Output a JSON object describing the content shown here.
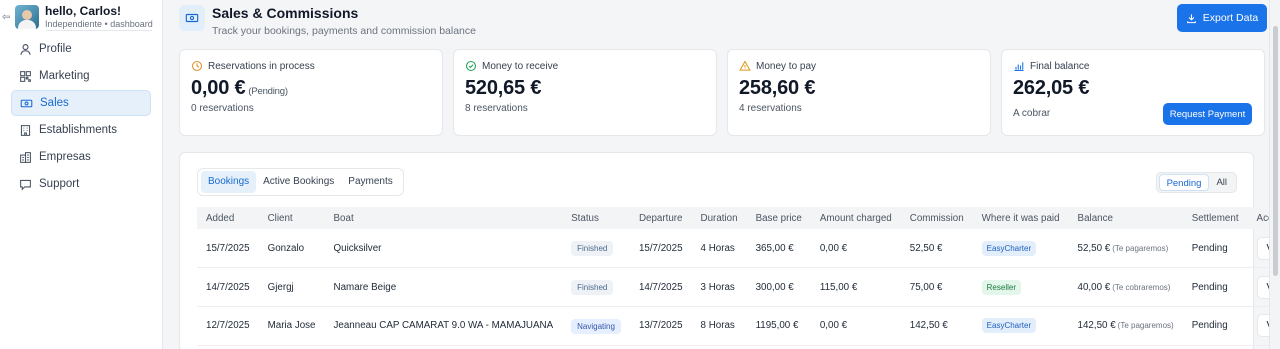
{
  "user": {
    "name": "hello, Carlos!",
    "subtitle": "Independiente • dashboard"
  },
  "sidebar": {
    "items": [
      {
        "label": "Profile",
        "icon": "user-icon"
      },
      {
        "label": "Marketing",
        "icon": "qr-icon"
      },
      {
        "label": "Sales",
        "icon": "sales-icon",
        "active": true
      },
      {
        "label": "Establishments",
        "icon": "building-icon"
      },
      {
        "label": "Empresas",
        "icon": "company-icon"
      },
      {
        "label": "Support",
        "icon": "chat-icon"
      }
    ]
  },
  "header": {
    "title": "Sales & Commissions",
    "subtitle": "Track your bookings, payments and commission balance",
    "export_label": "Export Data"
  },
  "cards": {
    "reservations": {
      "title": "Reservations in process",
      "amount": "0,00 €",
      "note": "(Pending)",
      "sub": "0 reservations"
    },
    "receive": {
      "title": "Money to receive",
      "amount": "520,65 €",
      "sub": "8 reservations"
    },
    "pay": {
      "title": "Money to pay",
      "amount": "258,60 €",
      "sub": "4 reservations"
    },
    "balance": {
      "title": "Final balance",
      "amount": "262,05 €",
      "sub": "A cobrar",
      "button": "Request Payment"
    }
  },
  "tabs": [
    "Bookings",
    "Active Bookings",
    "Payments"
  ],
  "filters": [
    "Pending",
    "All"
  ],
  "table": {
    "headers": [
      "Added",
      "Client",
      "Boat",
      "Status",
      "Departure",
      "Duration",
      "Base price",
      "Amount charged",
      "Commission",
      "Where it was paid",
      "Balance",
      "Settlement",
      "Acciones"
    ],
    "rows": [
      {
        "added": "15/7/2025",
        "client": "Gonzalo",
        "boat": "Quicksilver",
        "status": "Finished",
        "departure": "15/7/2025",
        "duration": "4 Horas",
        "base": "365,00 €",
        "charged": "0,00 €",
        "commission": "52,50 €",
        "paid": "EasyCharter",
        "balance": "52,50 €",
        "balance_note": "(Te pagaremos)",
        "settlement": "Pending",
        "action": "View details"
      },
      {
        "added": "14/7/2025",
        "client": "Gjergj",
        "boat": "Namare Beige",
        "status": "Finished",
        "departure": "14/7/2025",
        "duration": "3 Horas",
        "base": "300,00 €",
        "charged": "115,00 €",
        "commission": "75,00 €",
        "paid": "Reseller",
        "balance": "40,00 €",
        "balance_note": "(Te cobraremos)",
        "settlement": "Pending",
        "action": "View details"
      },
      {
        "added": "12/7/2025",
        "client": "Maria Jose",
        "boat": "Jeanneau CAP CAMARAT 9.0 WA - MAMAJUANA",
        "status": "Navigating",
        "departure": "13/7/2025",
        "duration": "8 Horas",
        "base": "1195,00 €",
        "charged": "0,00 €",
        "commission": "142,50 €",
        "paid": "EasyCharter",
        "balance": "142,50 €",
        "balance_note": "(Te pagaremos)",
        "settlement": "Pending",
        "action": "View details"
      }
    ]
  },
  "colors": {
    "accent": "#1a73e8",
    "active_bg": "#e6f0fb"
  }
}
